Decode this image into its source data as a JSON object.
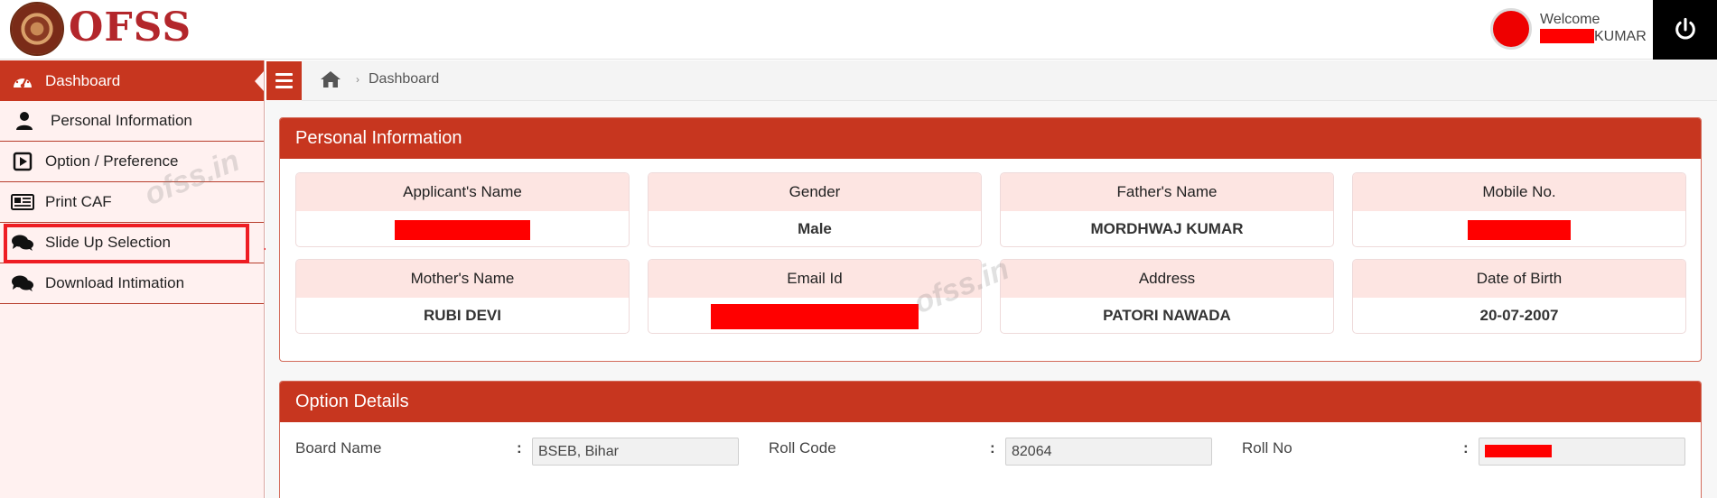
{
  "header": {
    "logo_text": "OFSS",
    "welcome_label": "Welcome",
    "user_suffix": "KUMAR"
  },
  "sidebar": {
    "items": [
      {
        "label": "Dashboard",
        "icon": "dashboard-icon",
        "active": true
      },
      {
        "label": "Personal Information",
        "icon": "user-icon"
      },
      {
        "label": "Option / Preference",
        "icon": "play-square-icon"
      },
      {
        "label": "Print CAF",
        "icon": "newspaper-icon"
      },
      {
        "label": "Slide Up Selection",
        "icon": "chat-bubbles-icon"
      },
      {
        "label": "Download Intimation",
        "icon": "chat-bubbles-icon"
      }
    ]
  },
  "breadcrumb": {
    "separator": "›",
    "current": "Dashboard"
  },
  "personal_info": {
    "title": "Personal Information",
    "fields": [
      {
        "label": "Applicant's Name",
        "value": "",
        "redacted": true
      },
      {
        "label": "Gender",
        "value": "Male"
      },
      {
        "label": "Father's Name",
        "value": "MORDHWAJ KUMAR"
      },
      {
        "label": "Mobile No.",
        "value": "",
        "redacted": true
      },
      {
        "label": "Mother's Name",
        "value": "RUBI DEVI"
      },
      {
        "label": "Email Id",
        "value": "",
        "redacted": true
      },
      {
        "label": "Address",
        "value": "PATORI NAWADA"
      },
      {
        "label": "Date of Birth",
        "value": "20-07-2007"
      }
    ]
  },
  "option_details": {
    "title": "Option Details",
    "fields": [
      {
        "label": "Board Name",
        "colon": ":",
        "value": "BSEB, Bihar"
      },
      {
        "label": "Roll Code",
        "colon": ":",
        "value": "82064"
      },
      {
        "label": "Roll No",
        "colon": ":",
        "value": "",
        "redacted": true
      }
    ]
  },
  "watermark": "ofss.in",
  "colors": {
    "brand_red": "#c7361f",
    "card_label_bg": "#fde5e2",
    "sidebar_bg": "#fff1f0",
    "redaction": "#ff0000"
  }
}
